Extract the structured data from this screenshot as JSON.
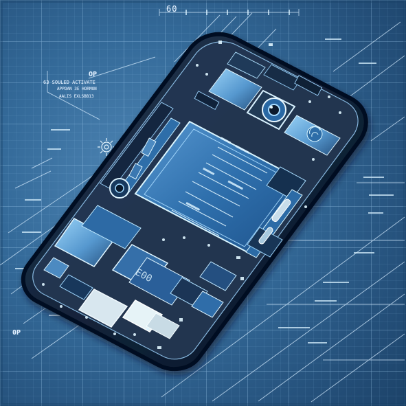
{
  "annotations": {
    "top_dimension": "60",
    "callout_title": "OP",
    "callout_line_1": "63 SOULED ACTIVATE",
    "callout_line_2": "APPDAN 3E HORMON",
    "callout_line_3": "AALIS EXLSBB13",
    "bottom_left_mark": "0P"
  },
  "colors": {
    "blueprint_background": "#346a99",
    "grid_line": "#8fc3ea",
    "phone_body": "#172334",
    "battery_panel": "#2f70ad",
    "circuit_chip": "#6fa8d8",
    "highlight": "#dff5ff"
  },
  "icons": {
    "main_camera": "camera-lens-icon",
    "side_camera": "side-lens-icon",
    "wireless_chip": "chip-icon"
  }
}
